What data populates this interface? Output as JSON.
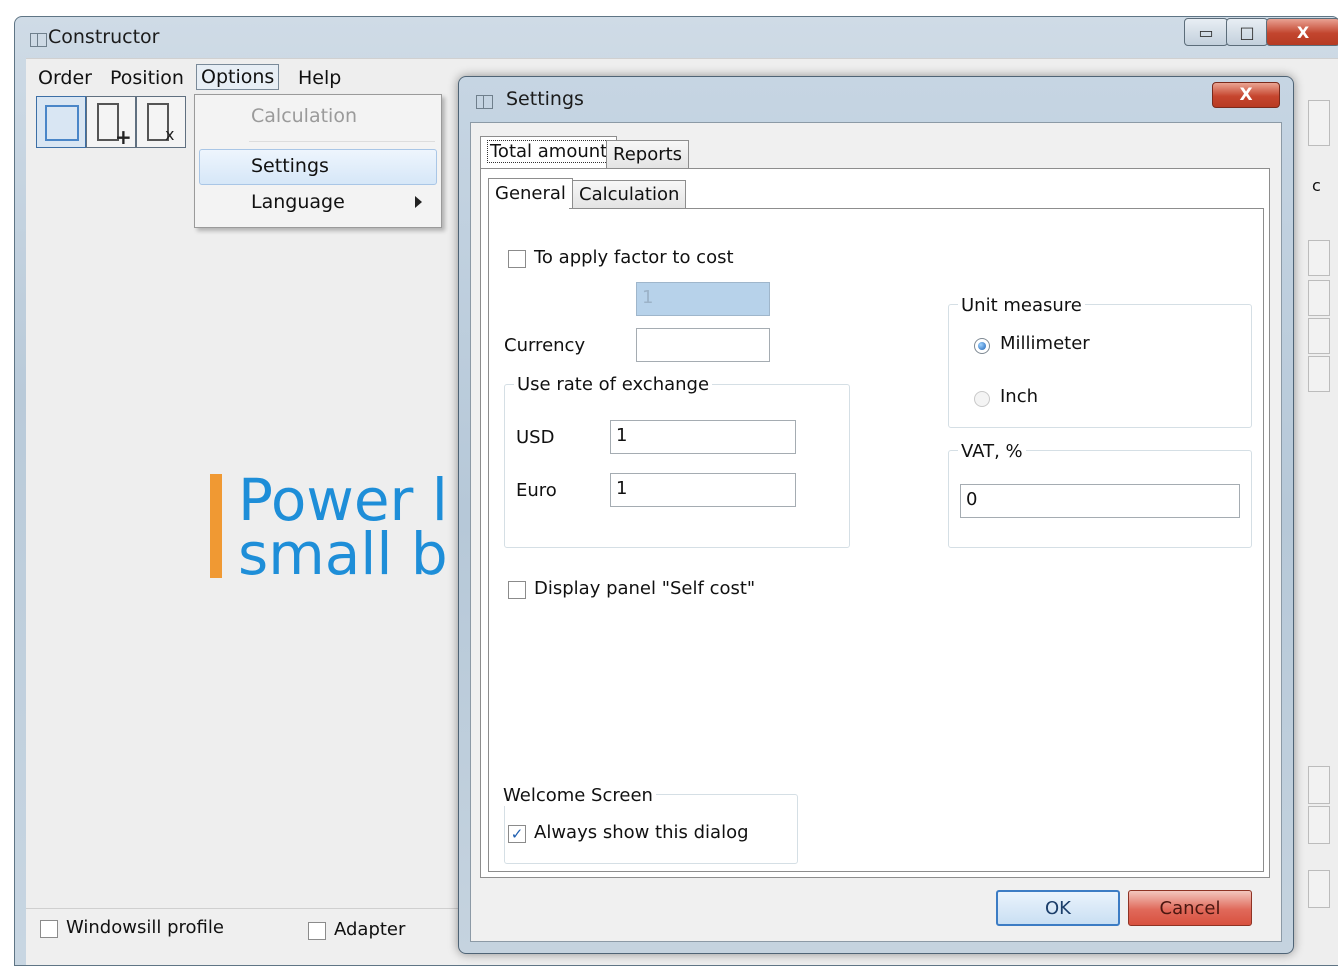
{
  "main_window": {
    "title": "Constructor",
    "menu": [
      "Order",
      "Position",
      "Options",
      "Help"
    ],
    "options_menu": {
      "items": [
        {
          "label": "Calculation",
          "enabled": false
        },
        {
          "label": "Settings",
          "enabled": true,
          "highlighted": true
        },
        {
          "label": "Language",
          "enabled": true,
          "submenu": true
        }
      ]
    },
    "logo_lines": [
      "Power l",
      "small b"
    ],
    "bottom": {
      "windowsill_profile": "Windowsill profile",
      "adapter": "Adapter"
    },
    "right_edge_glyph": "c"
  },
  "dialog": {
    "title": "Settings",
    "close_glyph": "X",
    "top_tabs": [
      "Total amount",
      "Reports"
    ],
    "sub_tabs": [
      "General",
      "Calculation"
    ],
    "apply_factor_label": "To apply factor to cost",
    "apply_factor_checked": false,
    "factor_value": "1",
    "currency_label": "Currency",
    "currency_value": "",
    "exchange_group_title": "Use rate of exchange",
    "usd_label": "USD",
    "usd_value": "1",
    "euro_label": "Euro",
    "euro_value": "1",
    "unit_group_title": "Unit measure",
    "unit_millimeter": "Millimeter",
    "unit_inch": "Inch",
    "unit_selected": "Millimeter",
    "vat_group_title": "VAT, %",
    "vat_value": "0",
    "self_cost_label": "Display panel \"Self cost\"",
    "self_cost_checked": false,
    "welcome_group_title": "Welcome Screen",
    "always_show_label": "Always show this dialog",
    "always_show_checked": true,
    "ok_label": "OK",
    "cancel_label": "Cancel"
  },
  "colors": {
    "logo_blue": "#1e8ed8",
    "logo_orange": "#f09933",
    "close_red": "#c6462f"
  }
}
